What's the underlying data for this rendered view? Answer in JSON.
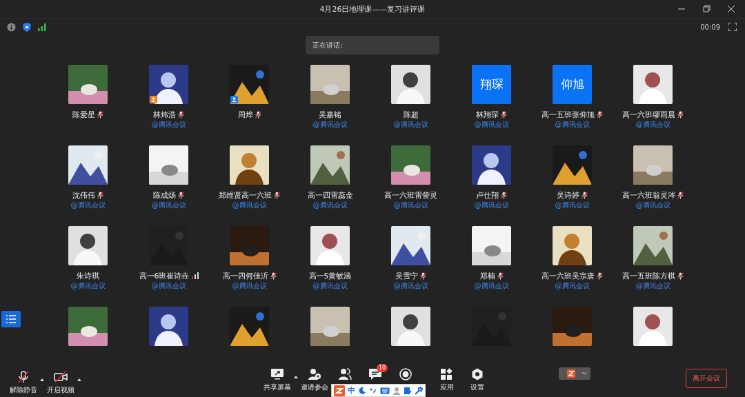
{
  "window": {
    "title": "4月26日地理课——复习讲评课"
  },
  "meeting": {
    "timer": "00:09",
    "speaking_label": "正在讲话:"
  },
  "participants": [
    {
      "name": "陈爱星",
      "muted": true,
      "talking": false,
      "avatar": {
        "kind": "picture"
      }
    },
    {
      "name": "林炜浩",
      "muted": true,
      "talking": false,
      "tag": "@腾讯会议",
      "avatar": {
        "kind": "picture",
        "badge": {
          "color": "#f0821e"
        }
      }
    },
    {
      "name": "周烨",
      "muted": true,
      "talking": false,
      "avatar": {
        "kind": "picture",
        "badge": {
          "color": "#1a7cf5"
        }
      }
    },
    {
      "name": "吴嘉铭",
      "muted": false,
      "talking": false,
      "tag": "@腾讯会议",
      "avatar": {
        "kind": "picture"
      }
    },
    {
      "name": "陈超",
      "muted": false,
      "talking": false,
      "tag": "@腾讯会议",
      "avatar": {
        "kind": "picture"
      }
    },
    {
      "name": "林翔琛",
      "muted": true,
      "talking": false,
      "tag": "@腾讯会议",
      "avatar": {
        "kind": "text",
        "text": "翔琛"
      }
    },
    {
      "name": "高一五班张仰旭",
      "muted": true,
      "talking": false,
      "tag": "@腾讯会议",
      "avatar": {
        "kind": "text",
        "text": "仰旭"
      }
    },
    {
      "name": "高一六班缪雨晨",
      "muted": true,
      "talking": false,
      "tag": "@腾讯会议",
      "avatar": {
        "kind": "picture"
      }
    },
    {
      "name": "沈伟伟",
      "muted": true,
      "talking": false,
      "tag": "@腾讯会议",
      "avatar": {
        "kind": "picture"
      }
    },
    {
      "name": "陈成炀",
      "muted": true,
      "talking": false,
      "tag": "@腾讯会议",
      "avatar": {
        "kind": "picture"
      }
    },
    {
      "name": "郑维贤高一六班",
      "muted": true,
      "talking": false,
      "tag": "@腾讯会议",
      "avatar": {
        "kind": "picture"
      }
    },
    {
      "name": "高一四雷蕊金",
      "muted": false,
      "talking": false,
      "tag": "@腾讯会议",
      "avatar": {
        "kind": "picture"
      }
    },
    {
      "name": "高一六班雷訾灵",
      "muted": false,
      "talking": false,
      "tag": "@腾讯会议",
      "avatar": {
        "kind": "picture"
      }
    },
    {
      "name": "卢仕翔",
      "muted": true,
      "talking": false,
      "tag": "@腾讯会议",
      "avatar": {
        "kind": "picture"
      }
    },
    {
      "name": "吴诗婷",
      "muted": true,
      "talking": false,
      "tag": "@腾讯会议",
      "avatar": {
        "kind": "picture"
      }
    },
    {
      "name": "高一六班翁灵涔",
      "muted": true,
      "talking": false,
      "tag": "@腾讯会议",
      "avatar": {
        "kind": "picture"
      }
    },
    {
      "name": "朱诗琪",
      "muted": false,
      "talking": false,
      "tag": "@腾讯会议",
      "avatar": {
        "kind": "picture"
      }
    },
    {
      "name": "高一6班崔诗垚",
      "muted": false,
      "talking": true,
      "tag": "@腾讯会议",
      "avatar": {
        "kind": "picture"
      }
    },
    {
      "name": "高一四何佳沂",
      "muted": true,
      "talking": false,
      "tag": "@腾讯会议",
      "avatar": {
        "kind": "picture"
      }
    },
    {
      "name": "高一5黄敏涵",
      "muted": false,
      "talking": false,
      "tag": "@腾讯会议",
      "avatar": {
        "kind": "picture"
      }
    },
    {
      "name": "吴雪宁",
      "muted": true,
      "talking": false,
      "tag": "@腾讯会议",
      "avatar": {
        "kind": "picture"
      }
    },
    {
      "name": "郑楠",
      "muted": true,
      "talking": false,
      "tag": "@腾讯会议",
      "avatar": {
        "kind": "picture"
      }
    },
    {
      "name": "高一六班吴宗唐",
      "muted": true,
      "talking": false,
      "tag": "@腾讯会议",
      "avatar": {
        "kind": "picture"
      }
    },
    {
      "name": "高一五班陈方棋",
      "muted": true,
      "talking": false,
      "tag": "@腾讯会议",
      "avatar": {
        "kind": "picture"
      }
    },
    {
      "avatar": {
        "kind": "picture"
      }
    },
    {
      "avatar": {
        "kind": "picture"
      }
    },
    {
      "avatar": {
        "kind": "picture"
      }
    },
    {
      "avatar": {
        "kind": "picture"
      }
    },
    {
      "avatar": {
        "kind": "picture"
      }
    },
    {
      "avatar": {
        "kind": "picture"
      }
    },
    {
      "avatar": {
        "kind": "picture"
      }
    },
    {
      "avatar": {
        "kind": "picture"
      }
    }
  ],
  "toolbar": [
    {
      "kind": "mic",
      "label": "解除静音",
      "caret": true
    },
    {
      "kind": "video",
      "label": "开启视频",
      "caret": true
    },
    {
      "kind": "share",
      "label": "共享屏幕",
      "caret": true
    },
    {
      "kind": "invite",
      "label": "邀请参会"
    },
    {
      "kind": "members"
    },
    {
      "kind": "chat",
      "badge": "10"
    },
    {
      "kind": "record"
    },
    {
      "kind": "apps",
      "label": "应用"
    },
    {
      "kind": "settings",
      "label": "设置"
    }
  ],
  "leave_button": "离开会议",
  "ime_bar": {
    "mode": "中"
  }
}
